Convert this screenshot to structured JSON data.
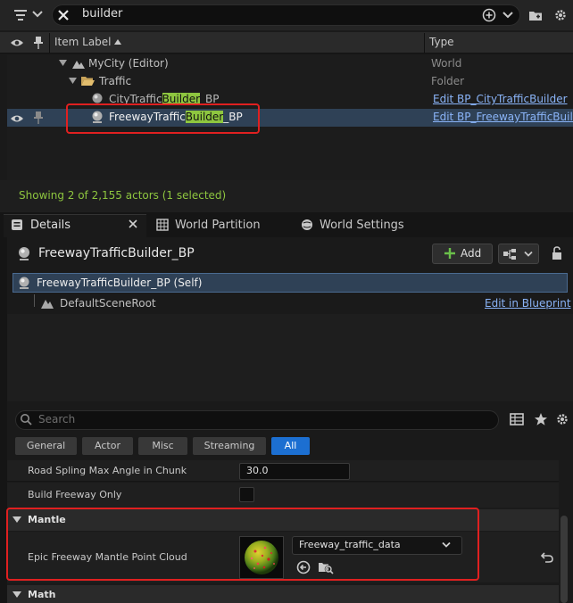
{
  "outliner": {
    "search_value": "builder",
    "col_item_label": "Item Label",
    "col_type": "Type",
    "rows": [
      {
        "label": "MyCity (Editor)",
        "type": "World"
      },
      {
        "label": "Traffic",
        "type": "Folder"
      },
      {
        "label_pre": "CityTraffic",
        "label_hl": "Builder",
        "label_post": "_BP",
        "type": "Edit BP_CityTrafficBuilder"
      },
      {
        "label_pre": "FreewayTraffic",
        "label_hl": "Builder",
        "label_post": "_BP",
        "type": "Edit BP_FreewayTrafficBuilder"
      }
    ],
    "status": "Showing 2 of 2,155 actors (1 selected)"
  },
  "tabs": {
    "details": "Details",
    "world_partition": "World Partition",
    "world_settings": "World Settings"
  },
  "details": {
    "actor_name": "FreewayTrafficBuilder_BP",
    "add_label": "Add",
    "self_row": "FreewayTrafficBuilder_BP (Self)",
    "root_component": "DefaultSceneRoot",
    "edit_in_blueprint": "Edit in Blueprint",
    "search_placeholder": "Search",
    "filters": [
      "General",
      "Actor",
      "Misc",
      "Streaming",
      "All"
    ],
    "props": {
      "max_angle_label": "Road Spling Max Angle in Chunk",
      "max_angle_value": "30.0",
      "freeway_only_label": "Build Freeway Only"
    },
    "mantle": {
      "section": "Mantle",
      "prop_label": "Epic Freeway Mantle Point Cloud",
      "asset_value": "Freeway_traffic_data"
    },
    "math_section": "Math"
  },
  "colors": {
    "accent": "#1c6fd1",
    "highlight": "#8ec63f",
    "selection": "#2f4156",
    "link": "#8ab4f8",
    "annotation": "#e02020",
    "status_text": "#8ec63f"
  }
}
